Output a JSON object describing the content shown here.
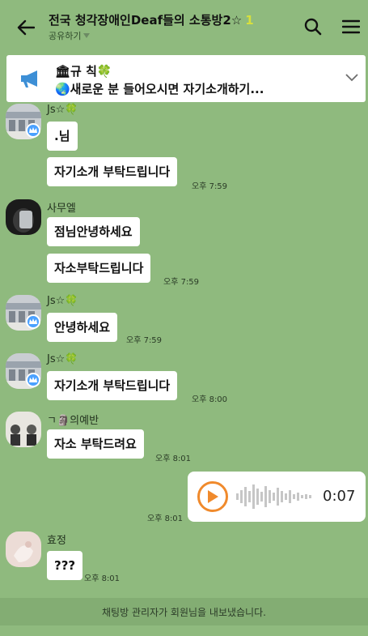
{
  "header": {
    "title": "전국 청각장애인Deaf들의 소통방2☆",
    "member_count": "1",
    "share_label": "공유하기"
  },
  "notice": {
    "title": "🏛규  칙🍀",
    "text": "🌏새로운 분 들어오시면 자기소개하기..."
  },
  "messages": [
    {
      "sender": "Js☆🍀",
      "bubbles": [
        ".님",
        "자기소개 부탁드립니다"
      ],
      "time": "오후 7:59"
    },
    {
      "sender": "사무엘",
      "bubbles": [
        "점님안녕하세요",
        "자소부탁드립니다"
      ],
      "time": "오후 7:59"
    },
    {
      "sender": "Js☆🍀",
      "bubbles": [
        "안녕하세요"
      ],
      "time": "오후 7:59"
    },
    {
      "sender": "Js☆🍀",
      "bubbles": [
        "자기소개 부탁드립니다"
      ],
      "time": "오후 8:00"
    },
    {
      "sender": "ㄱ🗿의예반",
      "bubbles": [
        "자소 부탁드려요"
      ],
      "time": "오후 8:01"
    },
    {
      "sender": "효정",
      "bubbles": [
        "???"
      ],
      "time": "오후 8:01"
    }
  ],
  "voice_message": {
    "duration": "0:07",
    "time": "오후 8:01"
  },
  "system_message": "채팅방 관리자가 회원님을 내보냈습니다.",
  "colors": {
    "background": "#8fba7e",
    "play_accent": "#f08a2c",
    "admin_badge": "#4aa1ff"
  },
  "icons": [
    "back-arrow-icon",
    "search-icon",
    "menu-icon",
    "megaphone-icon",
    "chevron-down-icon",
    "crown-icon",
    "play-icon"
  ]
}
